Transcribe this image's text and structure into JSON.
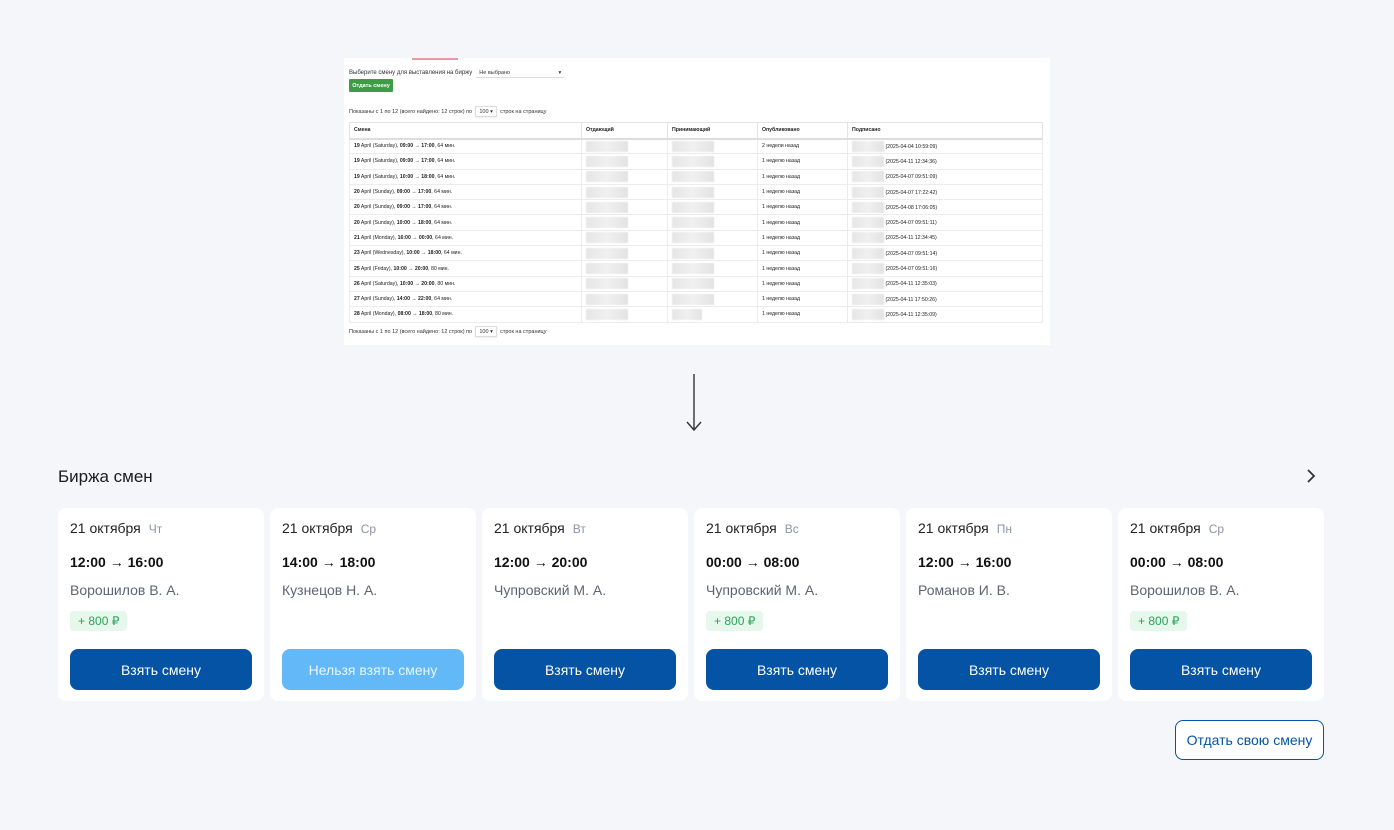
{
  "old_screen": {
    "select_label": "Выберите смену для выставления на биржу",
    "select_value": "Не выбрано",
    "give_button": "Отдать смену",
    "pager_top_prefix": "Показаны с 1 по 12 (всего найдено: 12 строк) по",
    "pager_bottom_prefix": "Показаны с 1 по 12 (всего найдено: 12 строк) по",
    "per_page": "100",
    "pager_suffix": "строк на страницу",
    "columns": [
      "Смена",
      "Отдающий",
      "Принимающий",
      "Опубликовано",
      "Подписано"
    ],
    "rows": [
      {
        "day": "19",
        "rest": " April (Saturday), ",
        "time": "09:00 → 17:00",
        "dur": ", 64 мин.",
        "published": "2 недели назад",
        "signed": "(2025-04-04 10:59:09)"
      },
      {
        "day": "19",
        "rest": " April (Saturday), ",
        "time": "09:00 → 17:00",
        "dur": ", 64 мин.",
        "published": "1 неделю назад",
        "signed": "(2025-04-11 12:34:36)"
      },
      {
        "day": "19",
        "rest": " April (Saturday), ",
        "time": "10:00 → 18:00",
        "dur": ", 64 мин.",
        "published": "1 неделю назад",
        "signed": "(2025-04-07 09:51:09)"
      },
      {
        "day": "20",
        "rest": " April (Sunday), ",
        "time": "09:00 → 17:00",
        "dur": ", 64 мин.",
        "published": "1 неделю назад",
        "signed": "(2025-04-07 17:22:42)"
      },
      {
        "day": "20",
        "rest": " April (Sunday), ",
        "time": "09:00 → 17:00",
        "dur": ", 64 мин.",
        "published": "1 неделю назад",
        "signed": "(2025-04-08 17:06:05)"
      },
      {
        "day": "20",
        "rest": " April (Sunday), ",
        "time": "10:00 → 18:00",
        "dur": ", 64 мин.",
        "published": "1 неделю назад",
        "signed": "(2025-04-07 09:51:11)"
      },
      {
        "day": "21",
        "rest": " April (Monday), ",
        "time": "16:00 → 00:00",
        "dur": ", 64 мин.",
        "published": "1 неделю назад",
        "signed": "(2025-04-11 12:34:45)"
      },
      {
        "day": "23",
        "rest": " April (Wednesday), ",
        "time": "10:00 → 18:00",
        "dur": ", 64 мин.",
        "published": "1 неделю назад",
        "signed": "(2025-04-07 09:51:14)"
      },
      {
        "day": "25",
        "rest": " April (Friday), ",
        "time": "10:00 → 20:00",
        "dur": ", 80 мин.",
        "published": "1 неделю назад",
        "signed": "(2025-04-07 09:51:16)"
      },
      {
        "day": "26",
        "rest": " April (Saturday), ",
        "time": "10:00 → 20:00",
        "dur": ", 80 мин.",
        "published": "1 неделю назад",
        "signed": "(2025-04-11 12:35:03)"
      },
      {
        "day": "27",
        "rest": " April (Sunday), ",
        "time": "14:00 → 22:00",
        "dur": ", 64 мин.",
        "published": "1 неделю назад",
        "signed": "(2025-04-11 17:50:26)"
      },
      {
        "day": "28",
        "rest": " April (Monday), ",
        "time": "08:00 → 18:00",
        "dur": ", 80 мин.",
        "published": "1 неделю назад",
        "signed": "(2025-04-11 12:35:09)"
      }
    ]
  },
  "exchange": {
    "title": "Биржа смен",
    "give_own_button": "Отдать свою смену",
    "cards": [
      {
        "date": "21 октября",
        "dow": "Чт",
        "time": "12:00 → 16:00",
        "name": "Ворошилов В. А.",
        "bonus": "+ 800 ₽",
        "button": "Взять смену",
        "disabled": false
      },
      {
        "date": "21 октября",
        "dow": "Ср",
        "time": "14:00 → 18:00",
        "name": "Кузнецов Н. А.",
        "bonus": "",
        "button": "Нельзя взять смену",
        "disabled": true
      },
      {
        "date": "21 октября",
        "dow": "Вт",
        "time": "12:00 → 20:00",
        "name": "Чупровский М. А.",
        "bonus": "",
        "button": "Взять смену",
        "disabled": false
      },
      {
        "date": "21 октября",
        "dow": "Вс",
        "time": "00:00 → 08:00",
        "name": "Чупровский М. А.",
        "bonus": "+ 800 ₽",
        "button": "Взять смену",
        "disabled": false
      },
      {
        "date": "21 октября",
        "dow": "Пн",
        "time": "12:00 → 16:00",
        "name": "Романов И. В.",
        "bonus": "",
        "button": "Взять смену",
        "disabled": false
      },
      {
        "date": "21 октября",
        "dow": "Ср",
        "time": "00:00 → 08:00",
        "name": "Ворошилов В. А.",
        "bonus": "+ 800 ₽",
        "button": "Взять смену",
        "disabled": false
      }
    ]
  },
  "colors": {
    "primary": "#0553a4",
    "disabled": "#63b8f8",
    "bonus": "#2aa35a",
    "old_green": "#3e9c47"
  }
}
